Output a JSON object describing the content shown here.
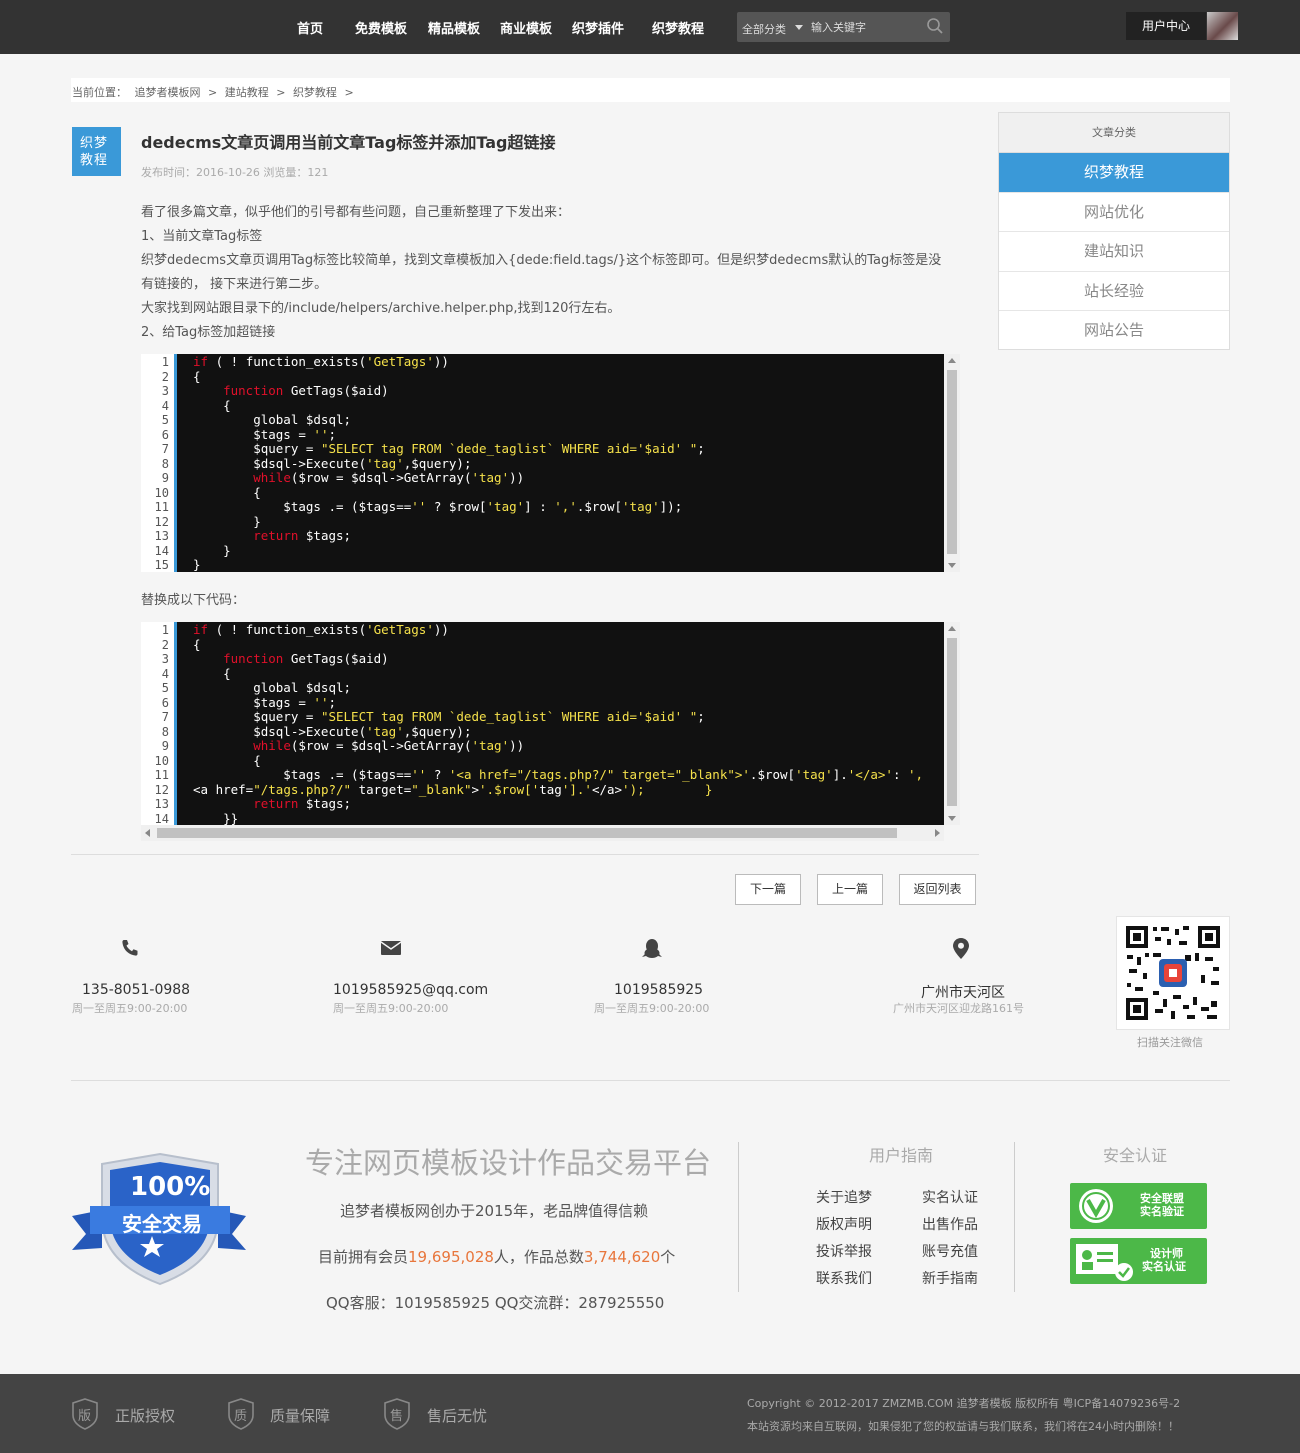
{
  "nav": {
    "items": [
      "首页",
      "免费模板",
      "精品模板",
      "商业模板",
      "织梦插件",
      "织梦教程"
    ],
    "search_category": "全部分类",
    "search_placeholder": "输入关键字",
    "user_center": "用户中心"
  },
  "breadcrumb": [
    "当前位置：",
    "追梦者模板网",
    ">",
    "建站教程",
    ">",
    "织梦教程",
    ">"
  ],
  "article": {
    "category_badge_line1": "织梦",
    "category_badge_line2": "教程",
    "title": "dedecms文章页调用当前文章Tag标签并添加Tag超链接",
    "meta": "发布时间：2016-10-26 浏览量：121",
    "paragraphs": [
      "看了很多篇文章，似乎他们的引号都有些问题，自己重新整理了下发出来：",
      "1、当前文章Tag标签",
      "织梦dedecms文章页调用Tag标签比较简单，找到文章模板加入{dede:field.tags/}这个标签即可。但是织梦dedecms默认的Tag标签是没",
      "有链接的， 接下来进行第二步。",
      "大家找到网站跟目录下的/include/helpers/archive.helper.php,找到120行左右。",
      "2、给Tag标签加超链接"
    ],
    "replace_text": "替换成以下代码：",
    "code1": [
      "if ( ! function_exists('GetTags'))",
      "{",
      "    function GetTags($aid)",
      "    {",
      "        global $dsql;",
      "        $tags = '';",
      "        $query = \"SELECT tag FROM `dede_taglist` WHERE aid='$aid' \";",
      "        $dsql->Execute('tag',$query);",
      "        while($row = $dsql->GetArray('tag'))",
      "        {",
      "            $tags .= ($tags=='' ? $row['tag'] : ','.$row['tag']);",
      "        }",
      "        return $tags;",
      "    }",
      "}"
    ],
    "code2": [
      "if ( ! function_exists('GetTags'))",
      "{",
      "    function GetTags($aid)",
      "    {",
      "        global $dsql;",
      "        $tags = '';",
      "        $query = \"SELECT tag FROM `dede_taglist` WHERE aid='$aid' \";",
      "        $dsql->Execute('tag',$query);",
      "        while($row = $dsql->GetArray('tag'))",
      "        {",
      "            $tags .= ($tags=='' ? '<a href=\"/tags.php?/\" target=\"_blank\">'.$row['tag'].'</a>': ',",
      "<a href=\"/tags.php?/\" target=\"_blank\">'.$row['tag'].'</a>');        }",
      "        return $tags;",
      "    }}"
    ],
    "pager": [
      "下一篇",
      "上一篇",
      "返回列表"
    ]
  },
  "sidebar": {
    "title": "文章分类",
    "items": [
      "织梦教程",
      "网站优化",
      "建站知识",
      "站长经验",
      "网站公告"
    ]
  },
  "contacts": [
    {
      "icon": "phone-icon",
      "main": "135-8051-0988",
      "sub": "周一至周五9:00-20:00"
    },
    {
      "icon": "mail-icon",
      "main": "1019585925@qq.com",
      "sub": "周一至周五9:00-20:00"
    },
    {
      "icon": "qq-icon",
      "main": "1019585925",
      "sub": "周一至周五9:00-20:00"
    },
    {
      "icon": "location-icon",
      "main": "广州市天河区",
      "sub": "广州市天河区迎龙路161号"
    }
  ],
  "qr_caption": "扫描关注微信",
  "footer": {
    "badge_line1": "100%",
    "badge_line2": "安全交易",
    "slogan": "专注网页模板设计作品交易平台",
    "since": "追梦者模板网创办于2015年，老品牌值得信赖",
    "members_prefix": "目前拥有会员",
    "members_count": "19,695,028",
    "members_mid": "人，作品总数",
    "works_count": "3,744,620",
    "members_suffix": "个",
    "qq_line": "QQ客服：1019585925  QQ交流群：287925550",
    "guide_title": "用户指南",
    "guide_links": [
      "关于追梦",
      "实名认证",
      "版权声明",
      "出售作品",
      "投诉举报",
      "账号充值",
      "联系我们",
      "新手指南"
    ],
    "security_title": "安全认证",
    "cert1_line1": "安全联盟",
    "cert1_line2": "实名验证",
    "cert2_line1": "设计师",
    "cert2_line2": "实名认证"
  },
  "bottom": {
    "badges": [
      {
        "char": "版",
        "label": "正版授权"
      },
      {
        "char": "质",
        "label": "质量保障"
      },
      {
        "char": "售",
        "label": "售后无忧"
      }
    ],
    "copyright": "Copyright © 2012-2017 ZMZMB.COM 追梦者模板 版权所有 粤ICP备14079236号-2",
    "notice": "本站资源均来自互联网，如果侵犯了您的权益请与我们联系，我们将在24小时内删除！！"
  },
  "colors": {
    "accent": "#3a99d8",
    "header_bg": "#333333",
    "highlight": "#e8763c",
    "cert_green": "#4cb848"
  }
}
